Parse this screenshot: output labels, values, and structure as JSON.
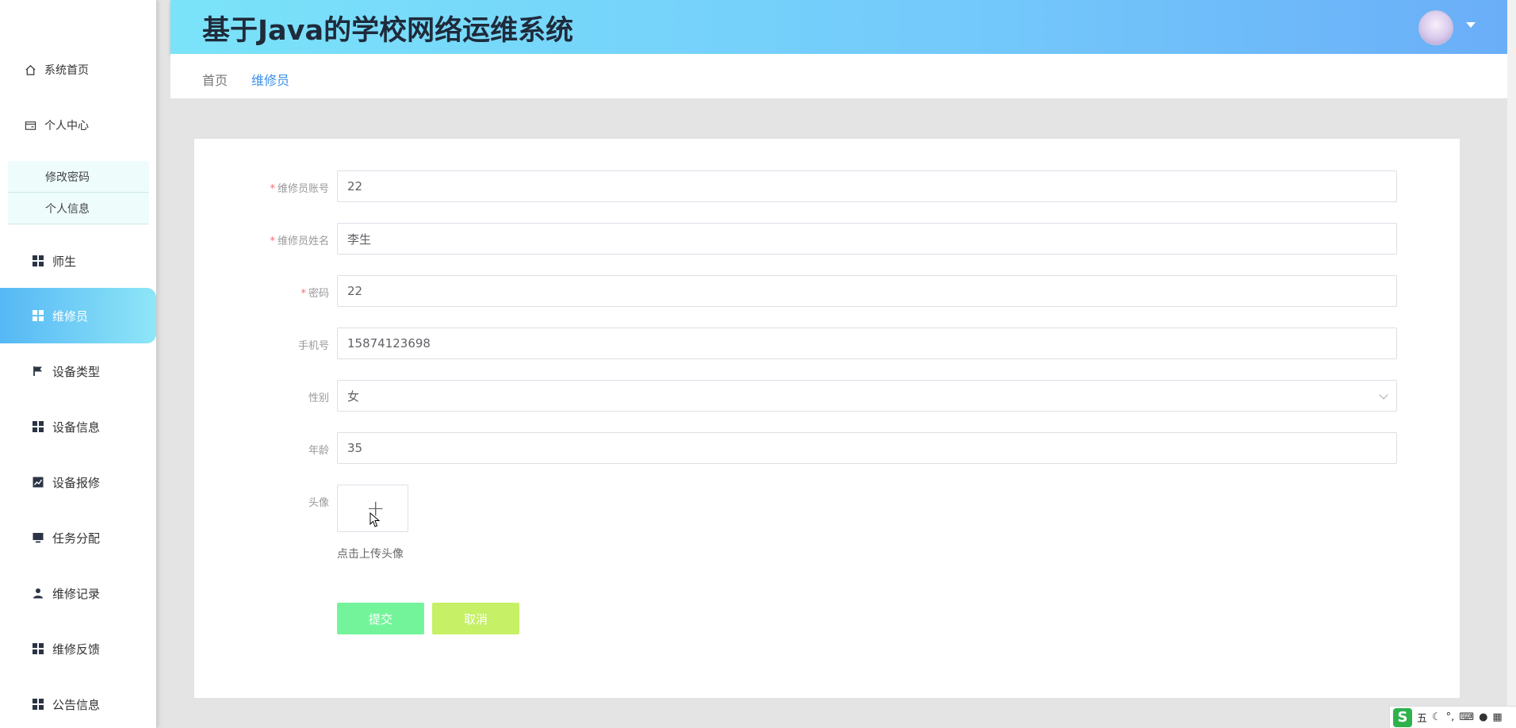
{
  "app": {
    "title": "基于Java的学校网络运维系统"
  },
  "sidebar": {
    "items": [
      {
        "label": "系统首页",
        "icon": "home-icon"
      },
      {
        "label": "个人中心",
        "icon": "id-card-icon"
      },
      {
        "label": "师生",
        "icon": "grid-icon"
      },
      {
        "label": "维修员",
        "icon": "grid-icon",
        "active": true
      },
      {
        "label": "设备类型",
        "icon": "flag-icon"
      },
      {
        "label": "设备信息",
        "icon": "grid-icon"
      },
      {
        "label": "设备报修",
        "icon": "chart-icon"
      },
      {
        "label": "任务分配",
        "icon": "monitor-icon"
      },
      {
        "label": "维修记录",
        "icon": "user-icon"
      },
      {
        "label": "维修反馈",
        "icon": "grid-icon"
      },
      {
        "label": "公告信息",
        "icon": "grid-icon"
      }
    ],
    "submenu": [
      {
        "label": "修改密码"
      },
      {
        "label": "个人信息"
      }
    ]
  },
  "breadcrumb": {
    "home": "首页",
    "current": "维修员"
  },
  "form": {
    "account": {
      "label": "维修员账号",
      "value": "22"
    },
    "name": {
      "label": "维修员姓名",
      "value": "李生"
    },
    "password": {
      "label": "密码",
      "value": "22"
    },
    "phone": {
      "label": "手机号",
      "value": "15874123698"
    },
    "gender": {
      "label": "性别",
      "value": "女"
    },
    "age": {
      "label": "年龄",
      "value": "35"
    },
    "avatar": {
      "label": "头像",
      "hint": "点击上传头像"
    },
    "submit_label": "提交",
    "cancel_label": "取消"
  },
  "tray": {
    "ime_label": "五"
  },
  "colors": {
    "header_gradient_start": "#7ae3f9",
    "header_gradient_end": "#6aaef8",
    "active_nav_start": "#56b8f5",
    "submit_button": "#74f49a",
    "cancel_button": "#c6f065",
    "required_star": "#f56c6c",
    "breadcrumb_current": "#3a8ee6"
  }
}
